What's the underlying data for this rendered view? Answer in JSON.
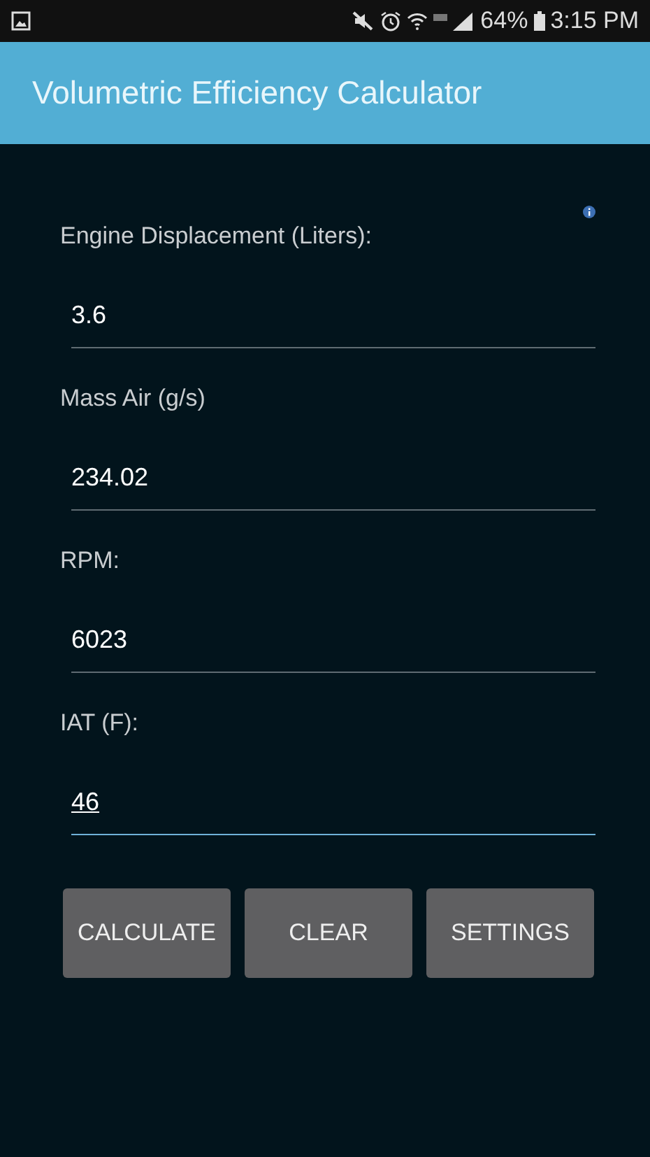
{
  "status_bar": {
    "battery": "64%",
    "time": "3:15 PM"
  },
  "app_bar": {
    "title": "Volumetric Efficiency Calculator"
  },
  "fields": [
    {
      "label": "Engine Displacement (Liters):",
      "value": "3.6",
      "focused": false
    },
    {
      "label": "Mass Air (g/s)",
      "value": "234.02",
      "focused": false
    },
    {
      "label": "RPM:",
      "value": "6023",
      "focused": false
    },
    {
      "label": "IAT (F):",
      "value": "46",
      "focused": true
    }
  ],
  "buttons": [
    "CALCULATE",
    "CLEAR",
    "SETTINGS"
  ]
}
